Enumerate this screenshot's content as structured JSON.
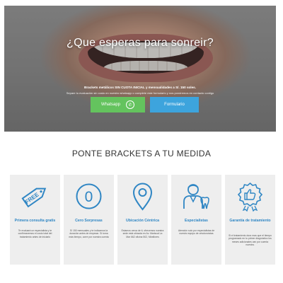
{
  "hero": {
    "title": "¿Que esperas para sonreir?",
    "subtitle": "Brackets metálicos SIN CUOTA INICIAL y mensualidades a S/. 150 soles.",
    "note": "Separe tu evaluación sin costo en nuestro whatsapp o complete este formulario y nos pondremos en contacto contigo",
    "whatsapp_label": "Whatsapp",
    "whatsapp_icon": "whatsapp-icon",
    "form_label": "Formulario",
    "colors": {
      "whatsapp": "#64c35e",
      "form": "#3da4dd"
    }
  },
  "section": {
    "title": "PONTE BRACKETS A TU MEDIDA",
    "accent": "#2f86c4",
    "cards": [
      {
        "icon": "free-tag-icon",
        "icon_text": "FREE",
        "title": "Primera consulta gratis",
        "desc": "Te evaluará un especialista y te confirmaremos el costo total del tratamiento antes de iniciarlo"
      },
      {
        "icon": "zero-circle-icon",
        "icon_text": "0",
        "title": "Cero Sorpresas",
        "desc": "S/ 150 mensuales y te indicamos la duración antes de empezar. Si toma más tiempo, corre por nuestra cuenta"
      },
      {
        "icon": "location-pin-icon",
        "title": "Ubicación Céntrica",
        "desc": "Estamos cerca de ti, ofrecemos nuestra sede está ubicada en Av. Mariscal La Mar 662 oficina 502, Miraflores"
      },
      {
        "icon": "specialists-icon",
        "title": "Especialistas",
        "desc": "Atención solo por especialistas de nuestro equipo de ortodoncistas"
      },
      {
        "icon": "thumbs-up-seal-icon",
        "title": "Garantía de tratamiento",
        "desc": "Si el tratamiento dura mas que el tiempo programado en tu primer diagnóstico los meses adicionales van por cuenta nuestra."
      }
    ]
  }
}
